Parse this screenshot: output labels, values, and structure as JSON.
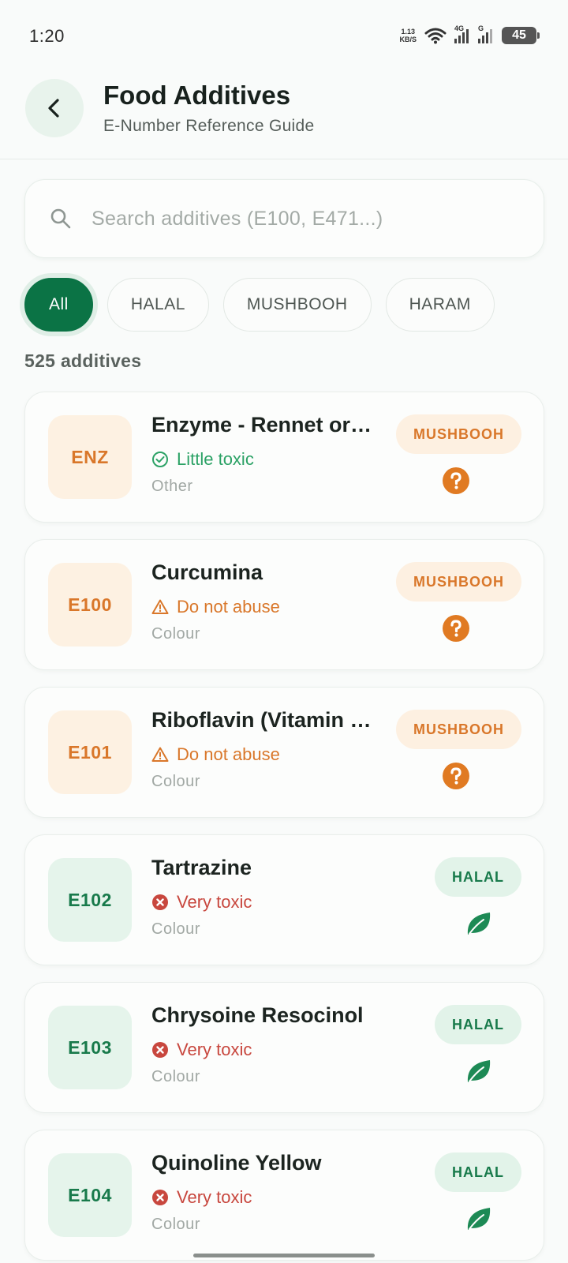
{
  "status_bar": {
    "time": "1:20",
    "net_speed_value": "1.13",
    "net_speed_unit": "KB/S",
    "signal_1_label": "4G",
    "signal_2_label": "G",
    "battery": "45"
  },
  "header": {
    "title": "Food Additives",
    "subtitle": "E-Number Reference Guide"
  },
  "search": {
    "placeholder": "Search additives (E100, E471...)"
  },
  "filters": [
    {
      "label": "All",
      "active": true
    },
    {
      "label": "HALAL",
      "active": false
    },
    {
      "label": "MUSHBOOH",
      "active": false
    },
    {
      "label": "HARAM",
      "active": false
    }
  ],
  "count_label": "525 additives",
  "colors": {
    "brand_green": "#0b7345",
    "mushbooh_orange": "#d9772a",
    "halal_green": "#187a4b",
    "toxic_red": "#c8473e",
    "little_toxic_green": "#2ca266"
  },
  "additives": [
    {
      "code": "ENZ",
      "name": "Enzyme - Rennet or…",
      "toxicity": "Little toxic",
      "toxicity_icon": "check-circle-icon",
      "category": "Other",
      "status": "MUSHBOOH",
      "status_icon": "question-icon"
    },
    {
      "code": "E100",
      "name": "Curcumina",
      "toxicity": "Do not abuse",
      "toxicity_icon": "warning-icon",
      "category": "Colour",
      "status": "MUSHBOOH",
      "status_icon": "question-icon"
    },
    {
      "code": "E101",
      "name": "Riboflavin (Vitamin …",
      "toxicity": "Do not abuse",
      "toxicity_icon": "warning-icon",
      "category": "Colour",
      "status": "MUSHBOOH",
      "status_icon": "question-icon"
    },
    {
      "code": "E102",
      "name": "Tartrazine",
      "toxicity": "Very toxic",
      "toxicity_icon": "x-circle-icon",
      "category": "Colour",
      "status": "HALAL",
      "status_icon": "leaf-icon"
    },
    {
      "code": "E103",
      "name": "Chrysoine Resocinol",
      "toxicity": "Very toxic",
      "toxicity_icon": "x-circle-icon",
      "category": "Colour",
      "status": "HALAL",
      "status_icon": "leaf-icon"
    },
    {
      "code": "E104",
      "name": "Quinoline Yellow",
      "toxicity": "Very toxic",
      "toxicity_icon": "x-circle-icon",
      "category": "Colour",
      "status": "HALAL",
      "status_icon": "leaf-icon"
    }
  ]
}
